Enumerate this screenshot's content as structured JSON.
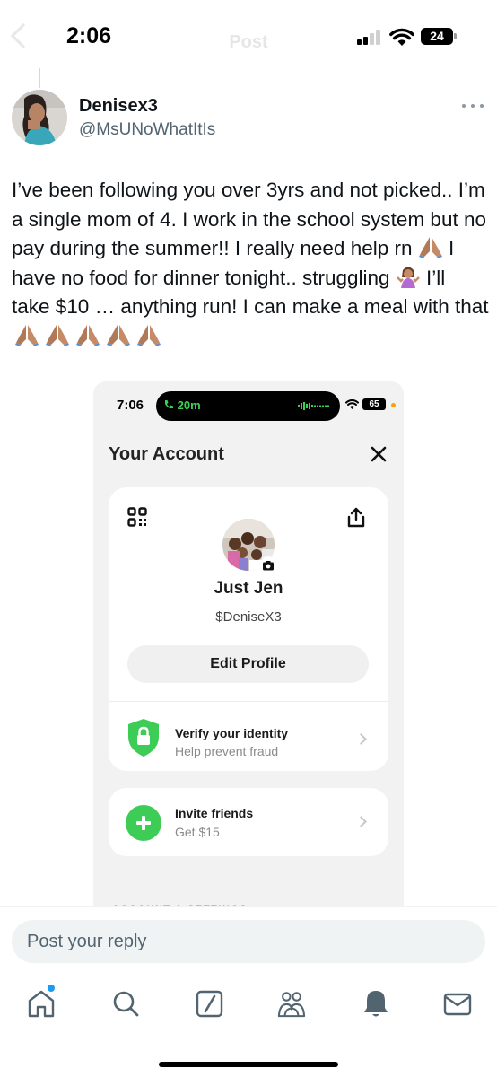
{
  "status_bar": {
    "time": "2:06",
    "battery": "24",
    "ghost_title": "Post"
  },
  "post": {
    "author_name": "Denisex3",
    "author_handle": "@MsUNoWhatItIs",
    "text_1": "I’ve been following you over 3yrs and not picked.. I’m a single mom of 4. I work in the school system but no pay during the summer!! I really need help rn ",
    "text_2": " I have no food for dinner tonight.. struggling ",
    "text_3": " I’ll take $10 … anything run! I can make a meal with that ",
    "emoji_icons": [
      "folded-hands-icon",
      "person-shrugging-icon",
      "folded-hands-icon"
    ]
  },
  "embedded_screenshot": {
    "status": {
      "time": "7:06",
      "call_timer": "20m",
      "battery": "65"
    },
    "title": "Your Account",
    "profile": {
      "name": "Just Jen",
      "cashtag": "$DeniseX3",
      "edit_label": "Edit Profile"
    },
    "verify": {
      "title": "Verify your identity",
      "subtitle": "Help prevent fraud"
    },
    "invite": {
      "title": "Invite friends",
      "subtitle": "Get $15"
    },
    "section_label": "ACCOUNT & SETTINGS",
    "colors": {
      "green": "#3dcc56",
      "background": "#f2f2f2"
    }
  },
  "reply": {
    "placeholder": "Post your reply"
  },
  "bottom_nav": {
    "items": [
      "home-icon",
      "search-icon",
      "grok-icon",
      "communities-icon",
      "notifications-icon",
      "messages-icon"
    ],
    "accent": "#1d9bf0"
  }
}
